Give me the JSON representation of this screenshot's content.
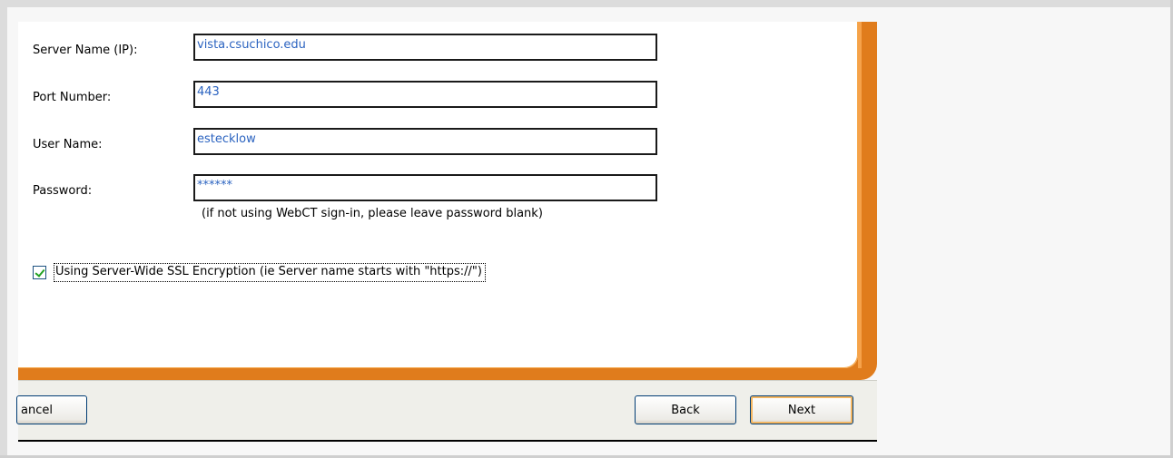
{
  "form": {
    "server_label": "Server Name (IP):",
    "server_value": "vista.csuchico.edu",
    "port_label": "Port Number:",
    "port_value": "443",
    "user_label": "User Name:",
    "user_value": "estecklow",
    "password_label": "Password:",
    "password_value": "******",
    "password_hint": "(if not using WebCT sign-in, please leave password blank)",
    "ssl_label": "Using Server-Wide SSL Encryption (ie Server name starts with \"https://\")",
    "ssl_checked": true
  },
  "buttons": {
    "cancel": "ancel",
    "back": "Back",
    "next": "Next"
  },
  "colors": {
    "accent": "#e07c1c",
    "input_text": "#2b63c0"
  }
}
